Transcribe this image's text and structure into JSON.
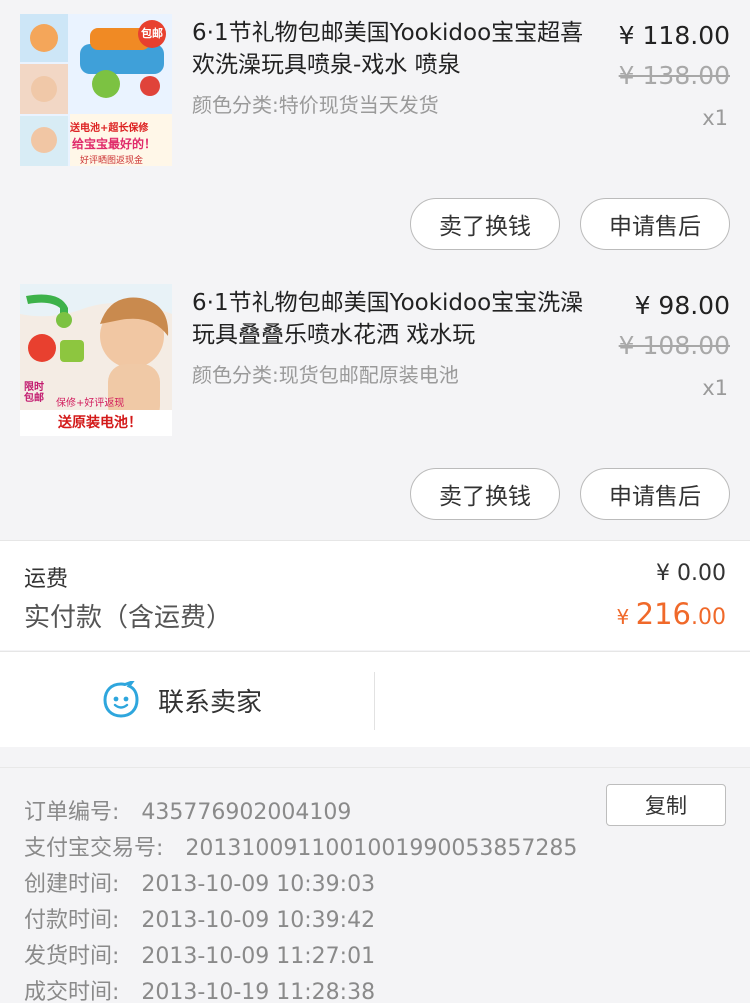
{
  "products": [
    {
      "title": "6·1节礼物包邮美国Yookidoo宝宝超喜欢洗澡玩具喷泉-戏水 喷泉",
      "sku": "颜色分类:特价现货当天发货",
      "price": "¥ 118.00",
      "original_price": "¥ 138.00",
      "qty": "x1",
      "sell_btn": "卖了换钱",
      "aftersale_btn": "申请售后",
      "thumb_text": [
        "包邮",
        "送电池+超长保修",
        "给宝宝最好的！",
        "好评晒图返现金"
      ]
    },
    {
      "title": "6·1节礼物包邮美国Yookidoo宝宝洗澡玩具叠叠乐喷水花洒 戏水玩",
      "sku": "颜色分类:现货包邮配原装电池",
      "price": "¥ 98.00",
      "original_price": "¥ 108.00",
      "qty": "x1",
      "sell_btn": "卖了换钱",
      "aftersale_btn": "申请售后",
      "thumb_text": [
        "限时包邮",
        "保修+好评返现",
        "送原装电池！"
      ]
    }
  ],
  "summary": {
    "shipping_label": "运费",
    "shipping_value": "¥ 0.00",
    "paid_label": "实付款（含运费）",
    "paid_currency": "¥ ",
    "paid_int": "216",
    "paid_dec": ".00"
  },
  "contact": {
    "label": "联系卖家",
    "icon": "chat-face-icon"
  },
  "order_info": {
    "copy_label": "复制",
    "rows": [
      {
        "k": "订单编号:",
        "v": "435776902004109"
      },
      {
        "k": "支付宝交易号:",
        "v": "2013100911001001990053857285"
      },
      {
        "k": "创建时间:",
        "v": "2013-10-09 10:39:03"
      },
      {
        "k": "付款时间:",
        "v": "2013-10-09 10:39:42"
      },
      {
        "k": "发货时间:",
        "v": "2013-10-09 11:27:01"
      },
      {
        "k": "成交时间:",
        "v": "2013-10-19 11:28:38"
      }
    ]
  },
  "colors": {
    "accent": "#f0692a",
    "muted": "#8a8a8a",
    "bg": "#f4f4f6"
  }
}
